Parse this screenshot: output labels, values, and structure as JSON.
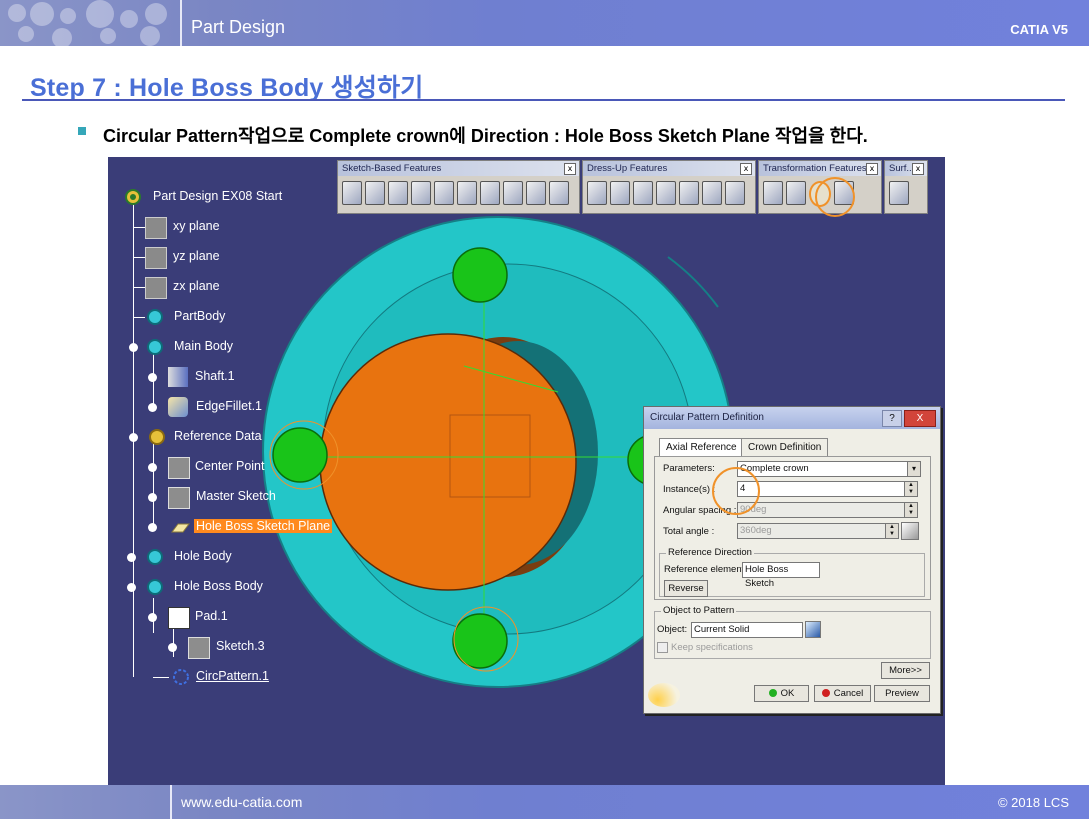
{
  "header": {
    "title": "Part Design",
    "brand": "CATIA V5"
  },
  "step_title": "Step 7 : Hole Boss Body 생성하기",
  "bullet": "Circular Pattern작업으로 Complete crown에 Direction : Hole Boss Sketch Plane 작업을 한다.",
  "tree": {
    "root": "Part Design EX08 Start",
    "items": [
      {
        "label": "xy plane"
      },
      {
        "label": "yz plane"
      },
      {
        "label": "zx plane"
      },
      {
        "label": "PartBody"
      },
      {
        "label": "Main Body"
      },
      {
        "label": "Shaft.1"
      },
      {
        "label": "EdgeFillet.1"
      },
      {
        "label": "Reference Data"
      },
      {
        "label": "Center Point"
      },
      {
        "label": "Master Sketch"
      },
      {
        "label": "Hole Boss Sketch Plane"
      },
      {
        "label": "Hole Body"
      },
      {
        "label": "Hole Boss Body"
      },
      {
        "label": "Pad.1"
      },
      {
        "label": "Sketch.3"
      },
      {
        "label": "CircPattern.1"
      }
    ]
  },
  "toolbars": [
    {
      "title": "Sketch-Based Features",
      "close": "x"
    },
    {
      "title": "Dress-Up Features",
      "close": "x"
    },
    {
      "title": "Transformation Features",
      "close": "x"
    },
    {
      "title": "Surf...",
      "close": "x"
    }
  ],
  "dialog": {
    "title": "Circular Pattern Definition",
    "help": "?",
    "close": "X",
    "tabs": [
      "Axial Reference",
      "Crown Definition"
    ],
    "parameters_label": "Parameters:",
    "parameters_value": "Complete crown",
    "instances_label": "Instance(s) :",
    "instances_value": "4",
    "angular_label": "Angular spacing :",
    "angular_value": "90deg",
    "total_label": "Total angle :",
    "total_value": "360deg",
    "ref_dir_title": "Reference Direction",
    "ref_elem_label": "Reference element:",
    "ref_elem_value": "Hole Boss Sketch",
    "reverse": "Reverse",
    "obj_title": "Object to Pattern",
    "object_label": "Object:",
    "object_value": "Current Solid",
    "keep_spec": "Keep specifications",
    "more": "More>>",
    "ok": "OK",
    "cancel": "Cancel",
    "preview": "Preview"
  },
  "footer": {
    "url": "www.edu-catia.com",
    "copyright": "© 2018 LCS"
  },
  "colors": {
    "accent": "#4a6fd6",
    "background3d": "#3a3d78",
    "flange": "#2ad2d2",
    "shaft": "#e8730f",
    "boss": "#22cc22",
    "highlight": "#f0922a"
  }
}
